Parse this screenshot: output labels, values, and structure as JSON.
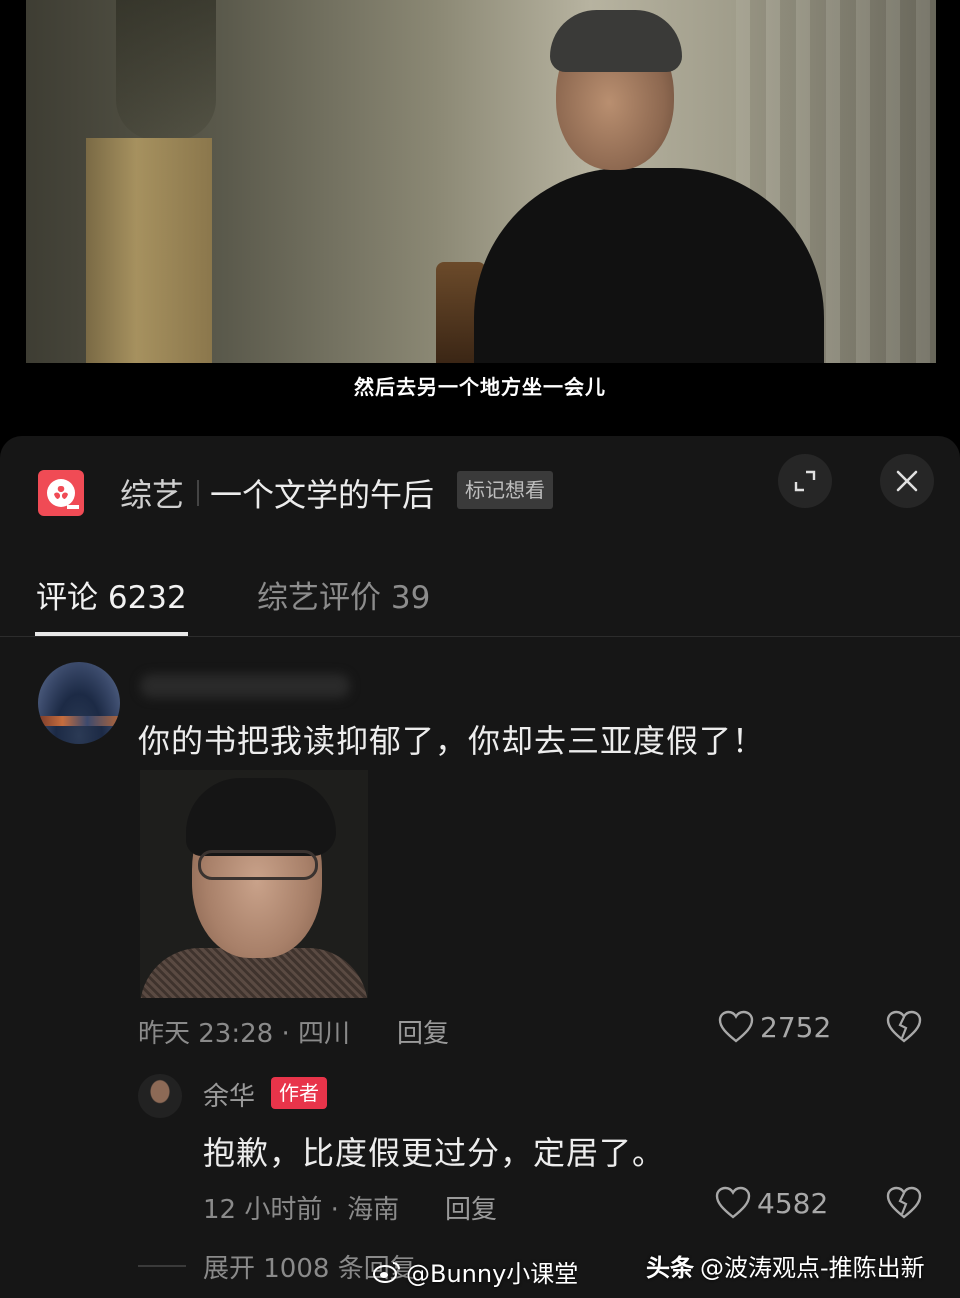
{
  "video": {
    "subtitle": "然后去另一个地方坐一会儿"
  },
  "header": {
    "category": "综艺",
    "title": "一个文学的午后",
    "mark_label": "标记想看",
    "icons": {
      "app": "film-reel-icon",
      "expand": "expand-icon",
      "close": "close-icon"
    },
    "accent_color": "#f04b55"
  },
  "tabs": [
    {
      "label": "评论 6232",
      "active": true
    },
    {
      "label": "综艺评价 39",
      "active": false
    }
  ],
  "comment": {
    "text": "你的书把我读抑郁了，你却去三亚度假了！",
    "meta": "昨天 23:28 · 四川",
    "reply_label": "回复",
    "likes": "2752"
  },
  "reply": {
    "name": "余华",
    "badge": "作者",
    "badge_color": "#e8344a",
    "text": "抱歉，比度假更过分，定居了。",
    "meta": "12 小时前 · 海南",
    "reply_label": "回复",
    "likes": "4582"
  },
  "expand_replies": "展开 1008 条回复",
  "watermarks": {
    "weibo": "@Bunny小课堂",
    "toutiao_brand": "头条",
    "toutiao_account": "@波涛观点-推陈出新"
  }
}
